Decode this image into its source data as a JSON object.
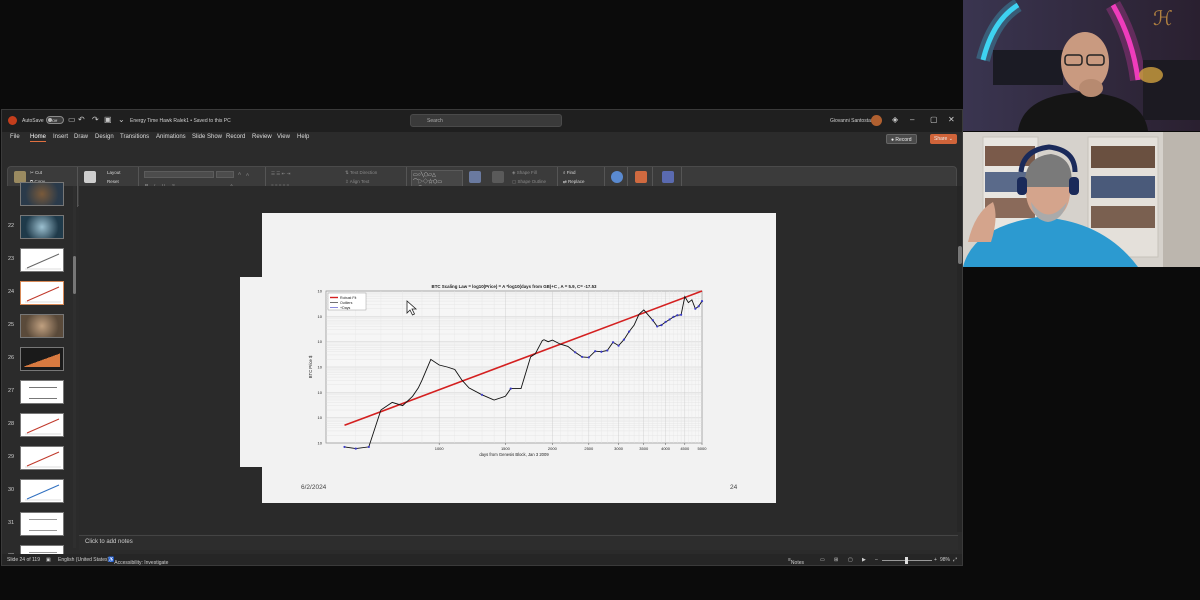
{
  "titlebar": {
    "autosave_label": "AutoSave",
    "autosave_state": "Off",
    "document_title": "Energy Time Hawk Ralek1 • Saved to this PC",
    "search_placeholder": "Search",
    "user_name": "Giovanni Santostasi"
  },
  "ribbon_tabs": [
    "File",
    "Home",
    "Insert",
    "Draw",
    "Design",
    "Transitions",
    "Animations",
    "Slide Show",
    "Record",
    "Review",
    "View",
    "Help"
  ],
  "active_tab": "Home",
  "record_button": "Record",
  "share_button": "Share",
  "ribbon": {
    "clipboard": {
      "paste": "Paste",
      "cut": "Cut",
      "copy": "Copy",
      "format_painter": "Format Painter",
      "group": "Clipboard"
    },
    "slides": {
      "new_slide": "New Slide",
      "layout": "Layout",
      "reset": "Reset",
      "section": "Section",
      "group": "Slides"
    },
    "font_group": "Font",
    "paragraph": {
      "text_direction": "Text Direction",
      "align_text": "Align Text",
      "smartart": "Convert to SmartArt",
      "group": "Paragraph"
    },
    "drawing": {
      "arrange": "Arrange",
      "quick_styles": "Quick Styles",
      "shape_fill": "Shape Fill",
      "shape_outline": "Shape Outline",
      "shape_effects": "Shape Effects",
      "group": "Drawing"
    },
    "editing": {
      "find": "Find",
      "replace": "Replace",
      "select": "Select",
      "group": "Editing"
    },
    "voice": {
      "dictate": "Dictate",
      "group": "Voice"
    },
    "addins": {
      "addins": "Add-ins",
      "group": "Add-ins"
    },
    "designer": "Designer"
  },
  "thumbnails": [
    {
      "number": "",
      "kind": "photo",
      "colors": [
        "#2a3a4a",
        "#7a5a3a"
      ]
    },
    {
      "number": "22",
      "kind": "photo",
      "colors": [
        "#1f3a4a",
        "#9cc0d0"
      ]
    },
    {
      "number": "23",
      "kind": "chart",
      "colors": [
        "#ffffff",
        "#666666"
      ]
    },
    {
      "number": "24",
      "kind": "chart-selected",
      "colors": [
        "#ffffff",
        "#c0392b"
      ]
    },
    {
      "number": "25",
      "kind": "photo",
      "colors": [
        "#5a4a3a",
        "#c0a080"
      ]
    },
    {
      "number": "26",
      "kind": "dark",
      "colors": [
        "#1a1a1a",
        "#d87a40"
      ]
    },
    {
      "number": "27",
      "kind": "text",
      "colors": [
        "#ffffff",
        "#777777"
      ]
    },
    {
      "number": "28",
      "kind": "chart",
      "colors": [
        "#ffffff",
        "#c0392b"
      ]
    },
    {
      "number": "29",
      "kind": "chart",
      "colors": [
        "#ffffff",
        "#c0392b"
      ]
    },
    {
      "number": "30",
      "kind": "chart",
      "colors": [
        "#ffffff",
        "#3070c0"
      ]
    },
    {
      "number": "31",
      "kind": "text",
      "colors": [
        "#ffffff",
        "#999999"
      ]
    },
    {
      "number": "32",
      "kind": "text",
      "colors": [
        "#ffffff",
        "#999999"
      ]
    }
  ],
  "slide": {
    "date": "6/2/2024",
    "number": "24"
  },
  "notes_placeholder": "Click to add notes",
  "statusbar": {
    "slide_info": "Slide 24 of 119",
    "language": "English (United States)",
    "accessibility": "Accessibility: Investigate",
    "notes": "Notes",
    "zoom": "98%"
  },
  "chart_data": {
    "type": "line",
    "title": "BTC Scaling Law = log10(Price) = A *log10(days from GB)+C , A = 5.9, C= -17.53",
    "xlabel": "days from Genesis Block, Jan 3 2009",
    "ylabel": "BTC Price $",
    "xscale": "log",
    "yscale": "log",
    "xlim": [
      500,
      5000
    ],
    "ylim": [
      0.1,
      100000
    ],
    "x_ticks": [
      "1000",
      "1500",
      "2000",
      "2500",
      "3000",
      "3500",
      "4000",
      "4500",
      "5000"
    ],
    "legend": [
      "Robust Fit",
      "Outliers",
      "+Days"
    ],
    "legend_position": "top-left",
    "grid": true,
    "colors": {
      "fit": "#d42020",
      "price": "#111111",
      "on_fit": "#3a3ac8"
    },
    "fit": {
      "A": 5.9,
      "C": -17.53
    },
    "series": [
      {
        "name": "Robust Fit",
        "x": [
          560,
          5000
        ],
        "y": [
          0.5,
          100000
        ]
      },
      {
        "x": [
          560,
          600,
          650,
          700,
          750,
          800,
          850,
          880,
          900,
          950,
          1000,
          1050,
          1100,
          1150,
          1200,
          1300,
          1400,
          1500,
          1550,
          1650,
          1750,
          1800,
          1880,
          1900,
          1950,
          2000,
          2100,
          2200,
          2300,
          2400,
          2500,
          2600,
          2700,
          2800,
          2900,
          3000,
          3100,
          3200,
          3300,
          3400,
          3500,
          3700,
          3800,
          3900,
          4000,
          4100,
          4200,
          4300,
          4400,
          4500,
          4600,
          4700,
          4800,
          4900,
          5000
        ],
        "y": [
          0.07,
          0.06,
          0.07,
          2,
          4,
          3,
          7,
          15,
          30,
          200,
          120,
          100,
          80,
          30,
          15,
          8,
          5,
          7,
          14,
          14,
          250,
          330,
          1100,
          1200,
          1000,
          1150,
          800,
          650,
          380,
          250,
          240,
          420,
          400,
          450,
          950,
          700,
          1200,
          2500,
          4500,
          12000,
          18000,
          7000,
          4000,
          4500,
          6000,
          7500,
          9500,
          11000,
          11500,
          60000,
          35000,
          45000,
          20000,
          25000,
          40000
        ]
      }
    ]
  }
}
